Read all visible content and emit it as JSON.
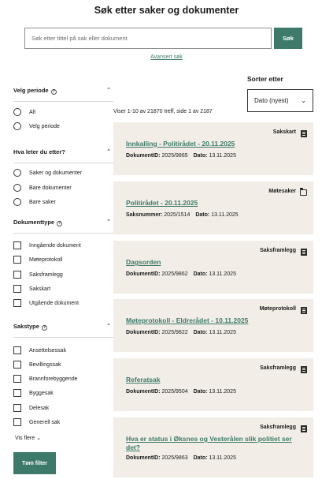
{
  "page_title": "Søk etter saker og dokumenter",
  "search": {
    "placeholder": "Søk etter tittel på sak eller dokument",
    "button_label": "Søk",
    "advanced_link": "Avansert søk"
  },
  "filters": {
    "period": {
      "title": "Velg periode",
      "options": [
        "Alt",
        "Velg periode"
      ]
    },
    "looking_for": {
      "title": "Hva leter du etter?",
      "options": [
        "Saker og dokumenter",
        "Bare dokumenter",
        "Bare saker"
      ]
    },
    "doc_type": {
      "title": "Dokumenttype",
      "options": [
        "Inngående dokument",
        "Møteprotokoll",
        "Saksframlegg",
        "Sakskart",
        "Utgående dokument"
      ]
    },
    "case_type": {
      "title": "Sakstype",
      "options": [
        "Ansettelsessak",
        "Bevillingssak",
        "Brannforebyggende",
        "Byggesak",
        "Delesak",
        "Generell sak"
      ],
      "show_more": "Vis flere"
    },
    "clear_button": "Tøm filter"
  },
  "sort": {
    "label": "Sorter etter",
    "selected": "Dato (nyest)"
  },
  "results": {
    "count_text": "Viser 1-10 av 21870 treff, side 1 av 2187",
    "items": [
      {
        "type": "Sakskart",
        "title": "Innkalling - Politirådet - 20.11.2025",
        "id_label": "DokumentID:",
        "id": "2025/9865",
        "date_label": "Dato:",
        "date": "13.11.2025",
        "icon": "document-icon"
      },
      {
        "type": "Møtesaker",
        "title": "Politirådet - 20.11.2025",
        "id_label": "Saksnummer:",
        "id": "2025/1514",
        "date_label": "Dato:",
        "date": "13.11.2025",
        "icon": "folder-icon"
      },
      {
        "type": "Saksframlegg",
        "title": "Dagsorden",
        "id_label": "DokumentID:",
        "id": "2025/9862",
        "date_label": "Dato:",
        "date": "13.11.2025",
        "icon": "document-icon"
      },
      {
        "type": "Møteprotokoll",
        "title": "Møteprotokoll - Eldrerådet - 10.11.2025",
        "id_label": "DokumentID:",
        "id": "2025/9822",
        "date_label": "Dato:",
        "date": "13.11.2025",
        "icon": "document-icon"
      },
      {
        "type": "Saksframlegg",
        "title": "Referatsak",
        "id_label": "DokumentID:",
        "id": "2025/9504",
        "date_label": "Dato:",
        "date": "13.11.2025",
        "icon": "document-icon"
      },
      {
        "type": "Saksframlegg",
        "title": "Hva er status i Øksnes og Vesterålen slik politiet ser det?",
        "id_label": "DokumentID:",
        "id": "2025/9863",
        "date_label": "Dato:",
        "date": "13.11.2025",
        "icon": "document-icon"
      }
    ]
  },
  "colors": {
    "accent": "#3d7a6a",
    "card_bg": "#f2eee7"
  }
}
